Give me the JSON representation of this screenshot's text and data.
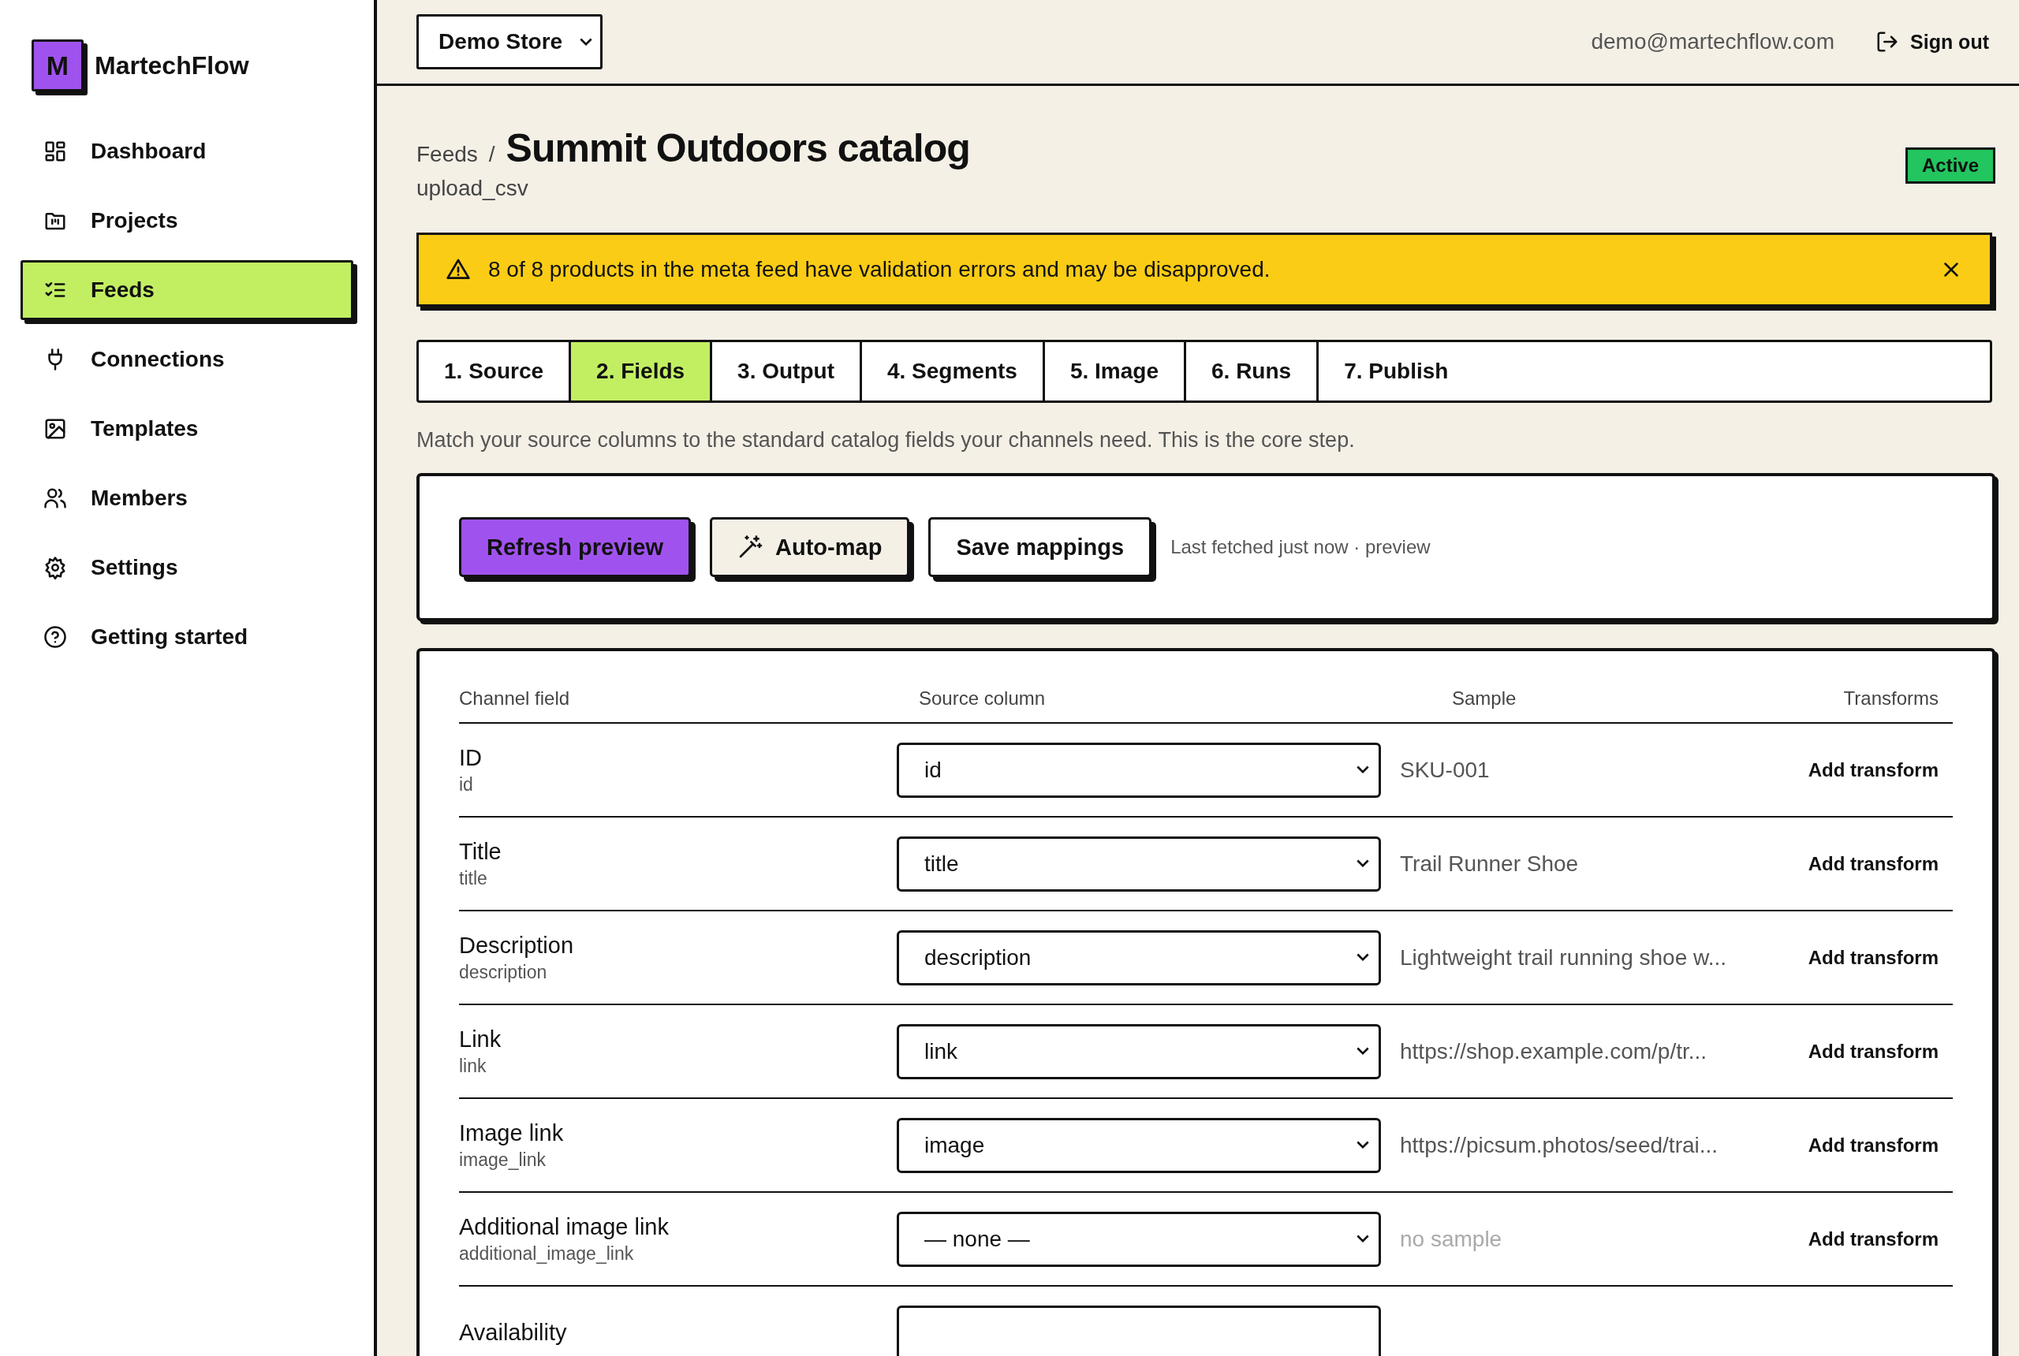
{
  "brand": {
    "logo_letter": "M",
    "name": "MartechFlow"
  },
  "sidebar": {
    "items": [
      {
        "label": "Dashboard",
        "selected": false
      },
      {
        "label": "Projects",
        "selected": false
      },
      {
        "label": "Feeds",
        "selected": true
      },
      {
        "label": "Connections",
        "selected": false
      },
      {
        "label": "Templates",
        "selected": false
      },
      {
        "label": "Members",
        "selected": false
      },
      {
        "label": "Settings",
        "selected": false
      },
      {
        "label": "Getting started",
        "selected": false
      }
    ]
  },
  "header": {
    "store_select": "Demo Store",
    "email": "demo@martechflow.com",
    "sign_out": "Sign out"
  },
  "page": {
    "breadcrumb": "Feeds",
    "separator": "/",
    "title": "Summit Outdoors catalog",
    "subtitle": "upload_csv",
    "status": "Active"
  },
  "alert": {
    "message": "8 of 8 products in the meta feed have validation errors and may be disapproved."
  },
  "tabs": [
    {
      "label": "1. Source",
      "selected": false
    },
    {
      "label": "2. Fields",
      "selected": true
    },
    {
      "label": "3. Output",
      "selected": false
    },
    {
      "label": "4. Segments",
      "selected": false
    },
    {
      "label": "5. Image",
      "selected": false
    },
    {
      "label": "6. Runs",
      "selected": false
    },
    {
      "label": "7. Publish",
      "selected": false
    }
  ],
  "description": "Match your source columns to the standard catalog fields your channels need. This is the core step.",
  "toolbar": {
    "buttons": [
      {
        "label": "Refresh preview",
        "kind": "primary"
      },
      {
        "label": "Auto-map",
        "kind": "wand"
      },
      {
        "label": "Save mappings",
        "kind": "plain"
      }
    ],
    "note": "Last fetched just now · preview"
  },
  "table": {
    "columns": [
      "Channel field",
      "Source column",
      "Sample",
      "Transforms"
    ],
    "rows": [
      {
        "name": "ID",
        "key": "id",
        "source": "id",
        "sample": "SKU-001",
        "sample_missing": false,
        "action": "Add transform"
      },
      {
        "name": "Title",
        "key": "title",
        "source": "title",
        "sample": "Trail Runner Shoe",
        "sample_missing": false,
        "action": "Add transform"
      },
      {
        "name": "Description",
        "key": "description",
        "source": "description",
        "sample": "Lightweight trail running shoe w...",
        "sample_missing": false,
        "action": "Add transform"
      },
      {
        "name": "Link",
        "key": "link",
        "source": "link",
        "sample": "https://shop.example.com/p/tr...",
        "sample_missing": false,
        "action": "Add transform"
      },
      {
        "name": "Image link",
        "key": "image_link",
        "source": "image",
        "sample": "https://picsum.photos/seed/trai...",
        "sample_missing": false,
        "action": "Add transform"
      },
      {
        "name": "Additional image link",
        "key": "additional_image_link",
        "source": "— none —",
        "sample": "no sample",
        "sample_missing": true,
        "action": "Add transform"
      },
      {
        "name": "Availability"
      }
    ]
  }
}
